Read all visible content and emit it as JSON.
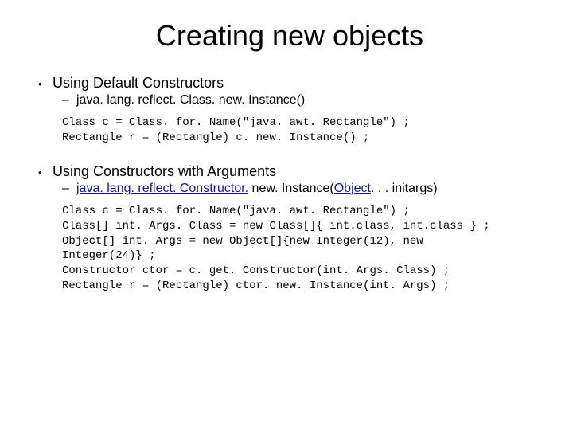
{
  "title": "Creating new objects",
  "sections": [
    {
      "bullet": "Using Default Constructors",
      "sub": {
        "plain": "java. lang. reflect. Class. new. Instance()",
        "link": ""
      },
      "code": "Class c = Class. for. Name(\"java. awt. Rectangle\") ;\nRectangle r = (Rectangle) c. new. Instance() ;"
    },
    {
      "bullet": "Using Constructors with Arguments",
      "sub": {
        "plain": "",
        "link_pre": "java. lang. reflect. Constructor.",
        "between": " new. Instance(",
        "link_mid": "Object",
        "after": ". . . initargs)"
      },
      "code": "Class c = Class. for. Name(\"java. awt. Rectangle\") ;\nClass[] int. Args. Class = new Class[]{ int.class, int.class } ;\nObject[] int. Args = new Object[]{new Integer(12), new\nInteger(24)} ;\nConstructor ctor = c. get. Constructor(int. Args. Class) ;\nRectangle r = (Rectangle) ctor. new. Instance(int. Args) ;"
    }
  ]
}
